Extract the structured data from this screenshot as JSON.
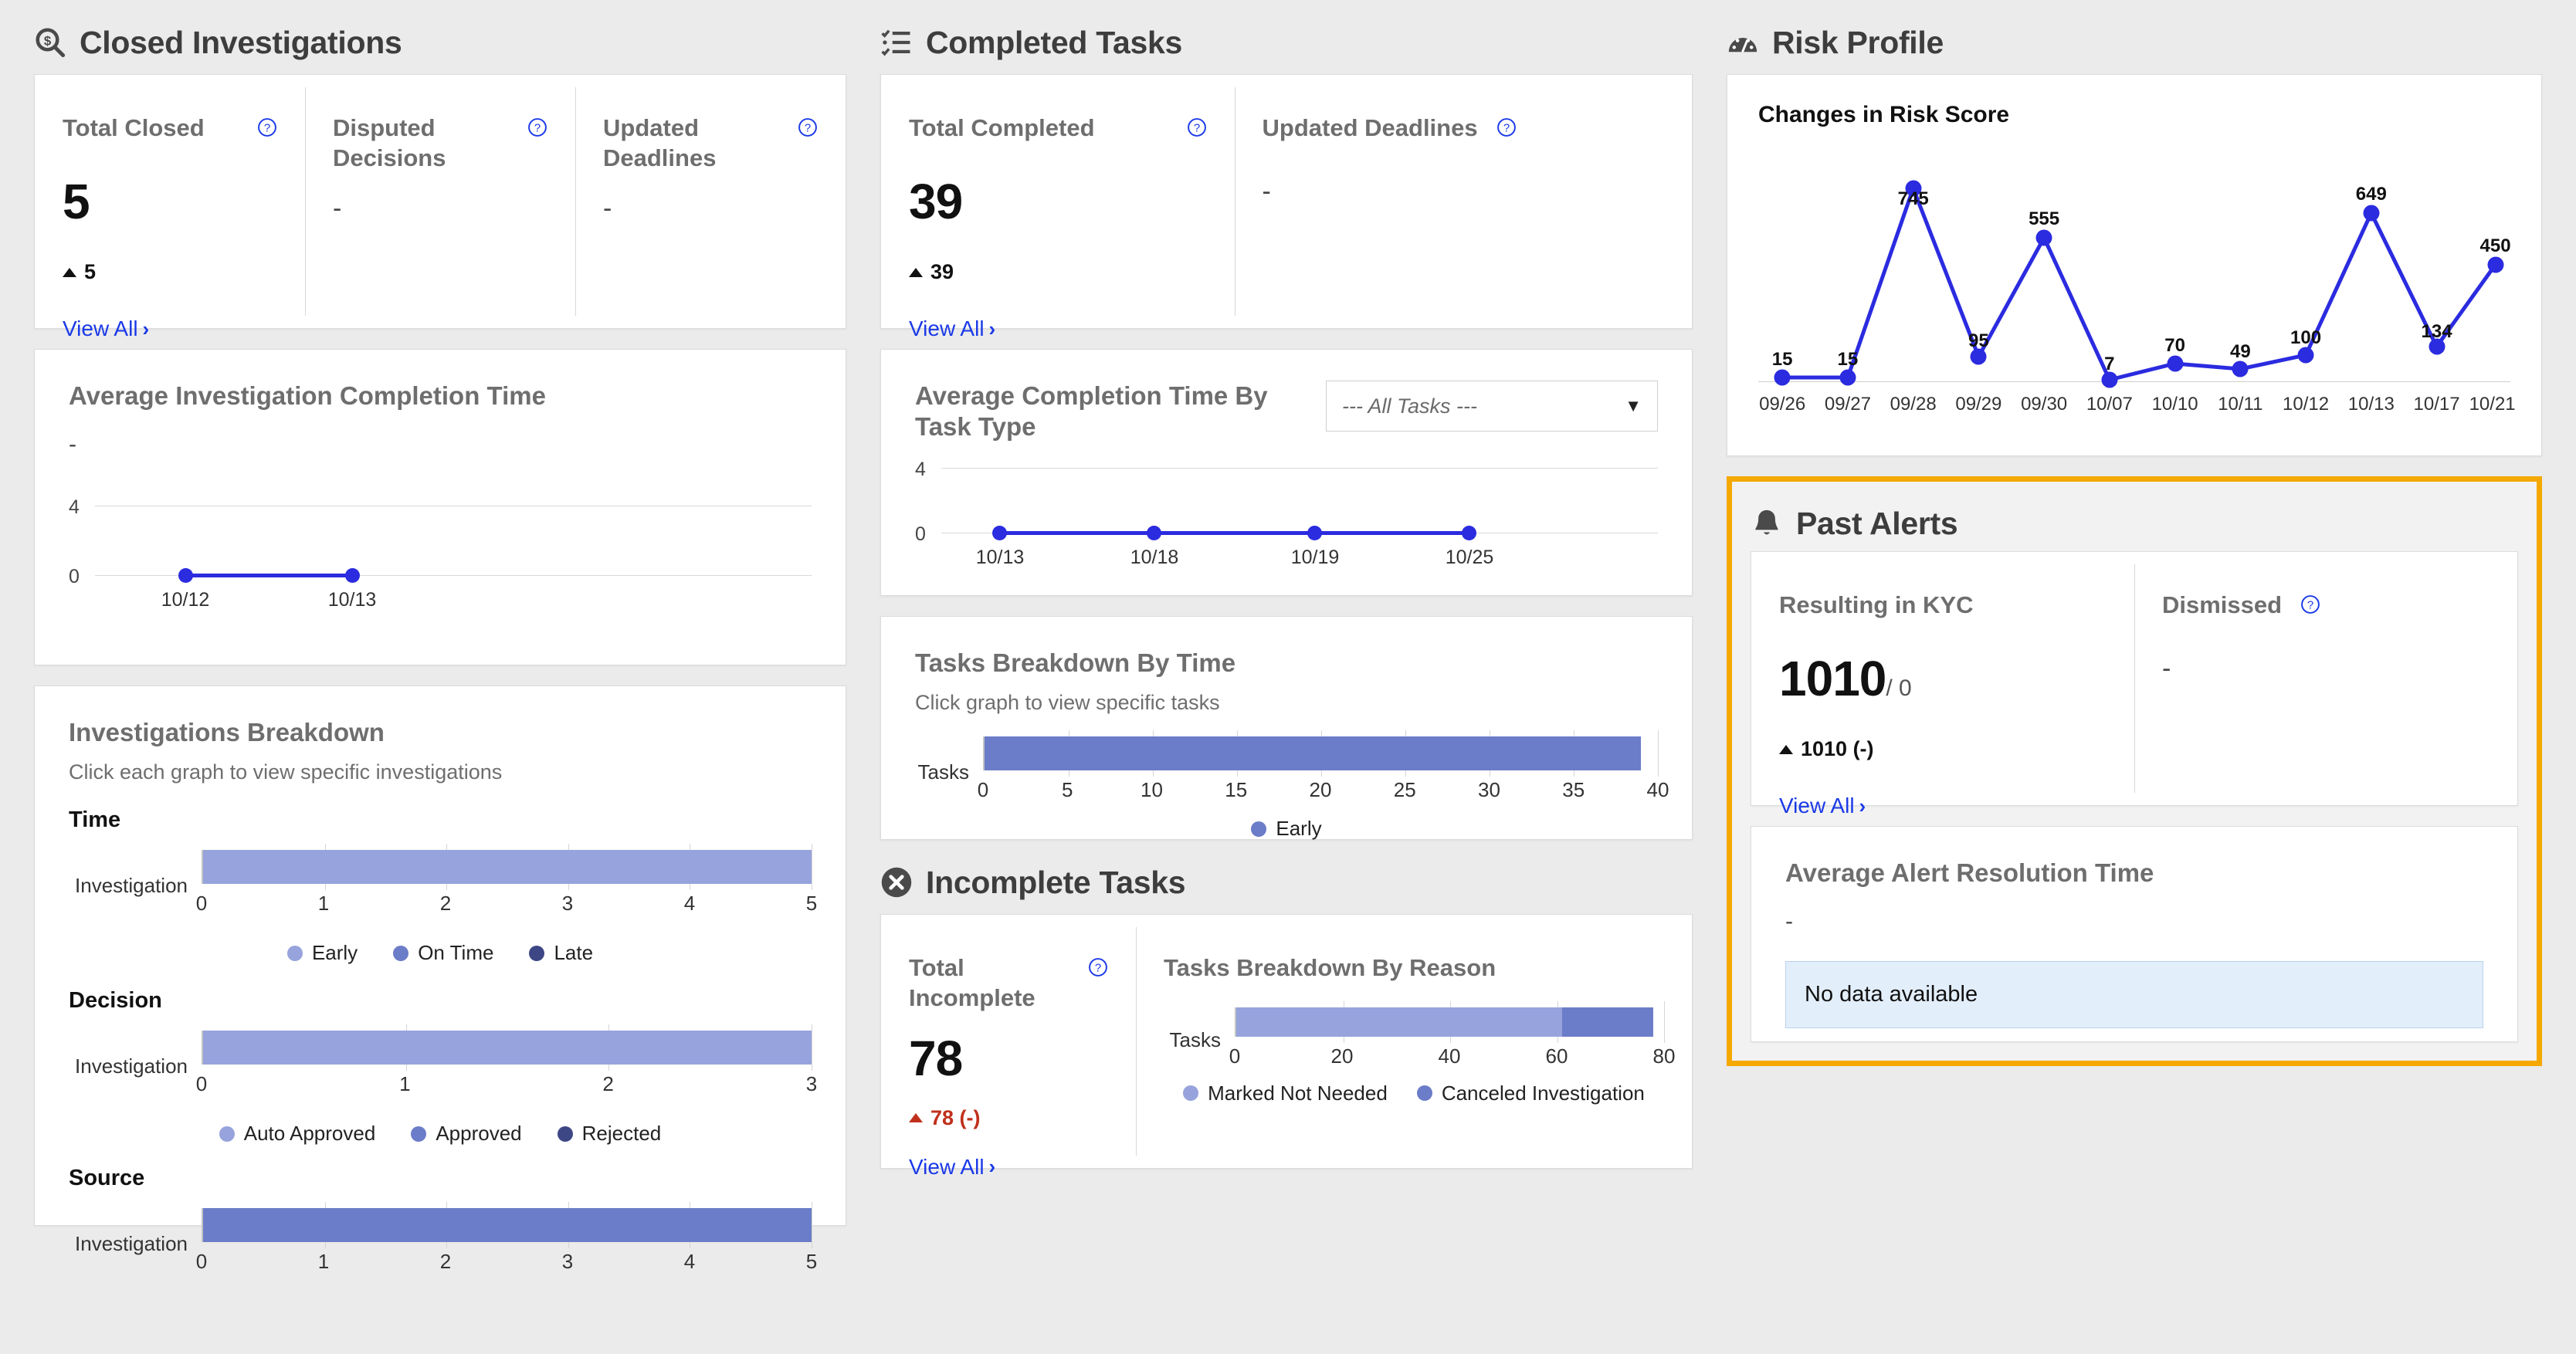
{
  "theme": {
    "accent_blue": "#1a39e8",
    "line_blue": "#2b2be0",
    "bar_light": "#96a3dc",
    "bar_medium": "#6b7cc8",
    "bar_dark": "#3d4785",
    "highlight_border": "#f5a800",
    "negative_red": "#c0301c",
    "page_bg": "#ebebeb"
  },
  "closed_investigations": {
    "title": "Closed Investigations",
    "icon": "magnifier-dollar-icon",
    "kpis": [
      {
        "label": "Total Closed",
        "value": "5",
        "delta": "5",
        "has_help": true,
        "has_view_all": true,
        "view_all": "View All"
      },
      {
        "label": "Disputed Decisions",
        "value": "-",
        "delta": null,
        "has_help": true,
        "has_view_all": false,
        "view_all": ""
      },
      {
        "label": "Updated Deadlines",
        "value": "-",
        "delta": null,
        "has_help": true,
        "has_view_all": false,
        "view_all": ""
      }
    ],
    "avg_completion": {
      "title": "Average Investigation Completion Time",
      "dash": "-"
    },
    "breakdown": {
      "title": "Investigations Breakdown",
      "subtitle": "Click each graph to view specific investigations",
      "groups": [
        {
          "name": "Time",
          "category": "Investigation",
          "legend": [
            "Early",
            "On Time",
            "Late"
          ]
        },
        {
          "name": "Decision",
          "category": "Investigation",
          "legend": [
            "Auto Approved",
            "Approved",
            "Rejected"
          ]
        },
        {
          "name": "Source",
          "category": "Investigation",
          "legend": []
        }
      ]
    }
  },
  "completed_tasks": {
    "title": "Completed Tasks",
    "icon": "checklist-icon",
    "kpis": [
      {
        "label": "Total Completed",
        "value": "39",
        "delta": "39",
        "has_help": true,
        "has_view_all": true,
        "view_all": "View All"
      },
      {
        "label": "Updated Deadlines",
        "value": "-",
        "delta": null,
        "has_help": true,
        "has_view_all": false,
        "view_all": ""
      }
    ],
    "avg_completion_by_type": {
      "title": "Average Completion Time By Task Type",
      "select_value": "--- All Tasks ---"
    },
    "tasks_breakdown_time": {
      "title": "Tasks Breakdown By Time",
      "subtitle": "Click graph to view specific tasks",
      "category": "Tasks",
      "legend": [
        "Early"
      ]
    }
  },
  "incomplete_tasks": {
    "title": "Incomplete Tasks",
    "icon": "circle-x-icon",
    "kpis": [
      {
        "label": "Total Incomplete",
        "value": "78",
        "delta": "78 (-)",
        "has_help": true,
        "has_view_all": true,
        "view_all": "View All"
      }
    ],
    "tasks_breakdown_reason": {
      "title": "Tasks Breakdown By Reason",
      "category": "Tasks",
      "legend": [
        "Marked Not Needed",
        "Canceled Investigation"
      ]
    }
  },
  "risk_profile": {
    "title": "Risk Profile",
    "icon": "gauge-icon",
    "chart_title": "Changes in Risk Score"
  },
  "past_alerts": {
    "title": "Past Alerts",
    "icon": "bell-icon",
    "kpis": [
      {
        "label": "Resulting in KYC",
        "value": "1010",
        "denom": "/ 0",
        "delta": "1010 (-)",
        "has_help": false,
        "has_view_all": true,
        "view_all": "View All"
      },
      {
        "label": "Dismissed",
        "value": "-",
        "denom": "",
        "delta": null,
        "has_help": true,
        "has_view_all": false,
        "view_all": ""
      }
    ],
    "avg_resolution": {
      "title": "Average Alert Resolution Time",
      "dash": "-",
      "empty_message": "No data available"
    }
  },
  "chart_data": [
    {
      "id": "changes_in_risk_score",
      "type": "line",
      "title": "Changes in Risk Score",
      "xlabel": "",
      "ylabel": "",
      "x": [
        "09/26",
        "09/27",
        "09/28",
        "09/29",
        "09/30",
        "10/07",
        "10/10",
        "10/11",
        "10/12",
        "10/13",
        "10/17",
        "10/21"
      ],
      "values": [
        15,
        15,
        745,
        95,
        555,
        7,
        70,
        49,
        100,
        649,
        134,
        450
      ],
      "labels": [
        "15",
        "15",
        "745",
        "95",
        "555",
        "7",
        "70",
        "49",
        "100",
        "649",
        "134",
        "450"
      ],
      "ylim": [
        0,
        745
      ],
      "grid": false,
      "legend": "none",
      "color": "#2b2be0"
    },
    {
      "id": "avg_investigation_completion_time",
      "type": "line",
      "title": "Average Investigation Completion Time",
      "x": [
        "10/12",
        "10/13"
      ],
      "values": [
        0,
        0
      ],
      "yticks": [
        0,
        4
      ],
      "ylim": [
        0,
        4
      ],
      "grid": true,
      "legend": "none",
      "color": "#2b2be0"
    },
    {
      "id": "avg_completion_time_by_task_type",
      "type": "line",
      "title": "Average Completion Time By Task Type",
      "x": [
        "10/13",
        "10/18",
        "10/19",
        "10/25"
      ],
      "values": [
        0,
        0,
        0,
        0
      ],
      "yticks": [
        0,
        4
      ],
      "ylim": [
        0,
        4
      ],
      "grid": true,
      "legend": "none",
      "color": "#2b2be0"
    },
    {
      "id": "investigations_breakdown_time",
      "type": "bar",
      "title": "Time",
      "orientation": "horizontal",
      "categories": [
        "Investigation"
      ],
      "series": [
        {
          "name": "Early",
          "values": [
            5
          ],
          "color": "#96a3dc"
        },
        {
          "name": "On Time",
          "values": [
            0
          ],
          "color": "#6b7cc8"
        },
        {
          "name": "Late",
          "values": [
            0
          ],
          "color": "#3d4785"
        }
      ],
      "xticks": [
        0,
        1,
        2,
        3,
        4,
        5
      ],
      "xlim": [
        0,
        5
      ],
      "legend": "bottom"
    },
    {
      "id": "investigations_breakdown_decision",
      "type": "bar",
      "title": "Decision",
      "orientation": "horizontal",
      "categories": [
        "Investigation"
      ],
      "series": [
        {
          "name": "Auto Approved",
          "values": [
            3
          ],
          "color": "#96a3dc"
        },
        {
          "name": "Approved",
          "values": [
            0
          ],
          "color": "#6b7cc8"
        },
        {
          "name": "Rejected",
          "values": [
            0
          ],
          "color": "#3d4785"
        }
      ],
      "xticks": [
        0,
        1,
        2,
        3
      ],
      "xlim": [
        0,
        3
      ],
      "legend": "bottom"
    },
    {
      "id": "investigations_breakdown_source",
      "type": "bar",
      "title": "Source",
      "orientation": "horizontal",
      "categories": [
        "Investigation"
      ],
      "series": [
        {
          "name": "Source",
          "values": [
            5
          ],
          "color": "#6b7cc8"
        }
      ],
      "xticks": [
        0,
        1,
        2,
        3,
        4,
        5
      ],
      "xlim": [
        0,
        5
      ],
      "legend": "none"
    },
    {
      "id": "tasks_breakdown_by_time",
      "type": "bar",
      "title": "Tasks Breakdown By Time",
      "orientation": "horizontal",
      "categories": [
        "Tasks"
      ],
      "series": [
        {
          "name": "Early",
          "values": [
            39
          ],
          "color": "#6b7cc8"
        }
      ],
      "xticks": [
        0,
        5,
        10,
        15,
        20,
        25,
        30,
        35,
        40
      ],
      "xlim": [
        0,
        40
      ],
      "legend": "bottom"
    },
    {
      "id": "tasks_breakdown_by_reason",
      "type": "bar",
      "title": "Tasks Breakdown By Reason",
      "orientation": "horizontal",
      "categories": [
        "Tasks"
      ],
      "series": [
        {
          "name": "Marked Not Needed",
          "values": [
            61
          ],
          "color": "#96a3dc"
        },
        {
          "name": "Canceled Investigation",
          "values": [
            17
          ],
          "color": "#6b7cc8"
        }
      ],
      "xticks": [
        0,
        20,
        40,
        60,
        80
      ],
      "xlim": [
        0,
        80
      ],
      "legend": "bottom"
    }
  ]
}
